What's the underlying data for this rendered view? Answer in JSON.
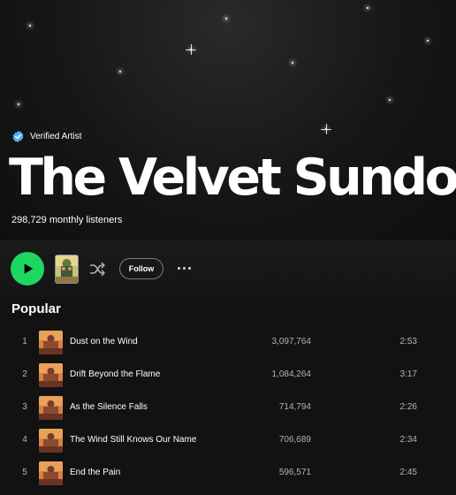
{
  "artist": {
    "verified_label": "Verified Artist",
    "name": "The Velvet Sundown",
    "monthly_listeners": "298,729 monthly listeners"
  },
  "actions": {
    "play": "play-icon",
    "shuffle": "shuffle-icon",
    "follow_label": "Follow",
    "more": "more-options-icon"
  },
  "popular": {
    "heading": "Popular",
    "tracks": [
      {
        "number": "1",
        "title": "Dust on the Wind",
        "plays": "3,097,764",
        "duration": "2:53"
      },
      {
        "number": "2",
        "title": "Drift Beyond the Flame",
        "plays": "1,084,264",
        "duration": "3:17"
      },
      {
        "number": "3",
        "title": "As the Silence Falls",
        "plays": "714,794",
        "duration": "2:26"
      },
      {
        "number": "4",
        "title": "The Wind Still Knows Our Name",
        "plays": "706,689",
        "duration": "2:34"
      },
      {
        "number": "5",
        "title": "End the Pain",
        "plays": "596,571",
        "duration": "2:45"
      }
    ]
  },
  "colors": {
    "accent": "#1ed760",
    "background": "#121212",
    "verified_badge": "#4cb3ff"
  }
}
